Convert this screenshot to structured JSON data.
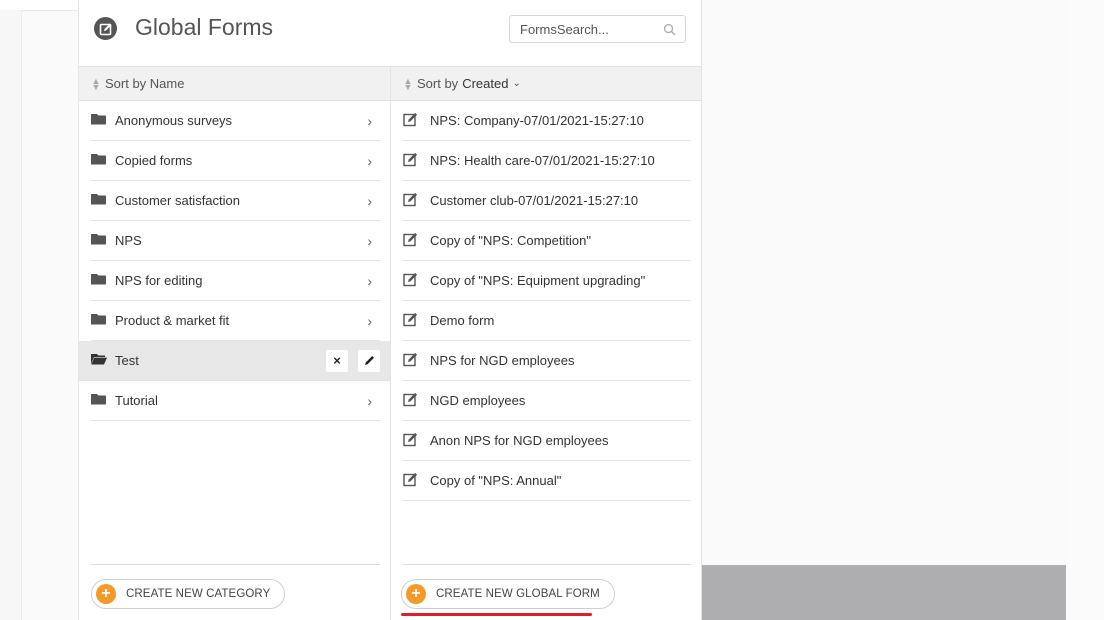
{
  "header": {
    "title": "Global Forms",
    "search_placeholder": "FormsSearch..."
  },
  "left_column": {
    "sort_label": "Sort by Name",
    "categories": [
      {
        "label": "Anonymous surveys"
      },
      {
        "label": "Copied forms"
      },
      {
        "label": "Customer satisfaction"
      },
      {
        "label": "NPS"
      },
      {
        "label": "NPS for editing"
      },
      {
        "label": "Product & market fit"
      },
      {
        "label": "Test"
      },
      {
        "label": "Tutorial"
      }
    ],
    "selected_index": 6,
    "delete_glyph": "×",
    "create_label": "CREATE NEW CATEGORY"
  },
  "middle_column": {
    "sort_prefix": "Sort by",
    "sort_value": "Created",
    "forms": [
      {
        "label": "NPS: Company-07/01/2021-15:27:10"
      },
      {
        "label": "NPS: Health care-07/01/2021-15:27:10"
      },
      {
        "label": "Customer club-07/01/2021-15:27:10"
      },
      {
        "label": "Copy of \"NPS: Competition\""
      },
      {
        "label": "Copy of \"NPS: Equipment upgrading\""
      },
      {
        "label": "Demo form"
      },
      {
        "label": "NPS for NGD employees"
      },
      {
        "label": "NGD employees"
      },
      {
        "label": "Anon NPS for NGD employees"
      },
      {
        "label": "Copy of \"NPS: Annual\""
      }
    ],
    "create_label": "CREATE NEW GLOBAL FORM"
  },
  "icons": {
    "header": "edit-square-icon",
    "folder": "folder-icon",
    "form": "edit-form-icon",
    "plus": "plus-circle-icon"
  },
  "colors": {
    "accent": "#f39a2b",
    "highlight_underline": "#d8202a",
    "selected_row": "#e7e7e7",
    "right_panel_block": "#aeaeb0"
  }
}
